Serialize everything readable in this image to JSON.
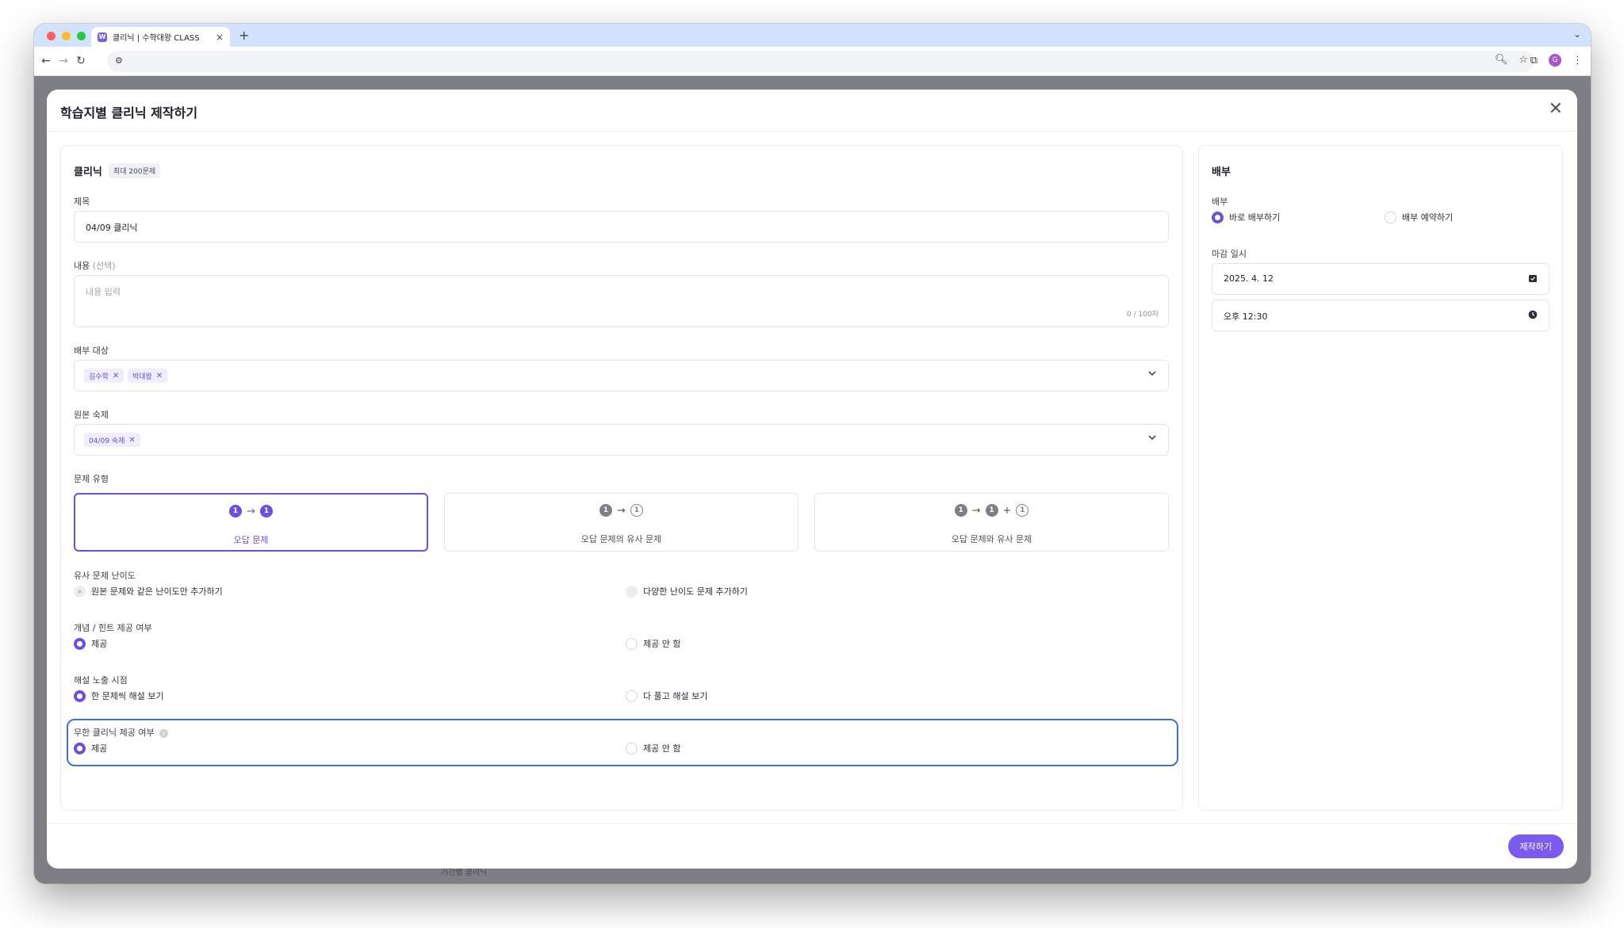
{
  "browser": {
    "tab_title": "클리닉 | 수학대왕 CLASS",
    "tab_favicon": "W",
    "new_tab": "+",
    "close_tab": "×",
    "profile_initial": "G",
    "accent": "#d3e3fd"
  },
  "background_hint": "기간별 클리닉",
  "modal": {
    "title": "학습지별 클리닉 제작하기",
    "close": "✕",
    "submit_label": "제작하기"
  },
  "clinic": {
    "section_title": "클리닉",
    "badge": "최대 200문제",
    "title_label": "제목",
    "title_value": "04/09 클리닉",
    "content_label": "내용",
    "content_optional": "(선택)",
    "content_placeholder": "내용 입력",
    "content_counter": "0 / 100자",
    "targets_label": "배부 대상",
    "targets": [
      "김수학",
      "박대왕"
    ],
    "homework_label": "원본 숙제",
    "homework": [
      "04/09 숙제"
    ],
    "type_label": "문제 유형",
    "types": [
      {
        "label": "오답 문제",
        "selected": true
      },
      {
        "label": "오답 문제의 유사 문제",
        "selected": false
      },
      {
        "label": "오답 문제와 유사 문제",
        "selected": false
      }
    ],
    "difficulty_label": "유사 문제 난이도",
    "difficulty_options": [
      "원본 문제와 같은 난이도만 추가하기",
      "다양한 난이도 문제 추가하기"
    ],
    "hint_label": "개념 / 힌트 제공 여부",
    "hint_options": [
      "제공",
      "제공 안 함"
    ],
    "solution_label": "해설 노출 시점",
    "solution_options": [
      "한 문제씩 해설 보기",
      "다 풀고 해설 보기"
    ],
    "infinite_label": "무한 클리닉 제공 여부",
    "infinite_options": [
      "제공",
      "제공 안 함"
    ]
  },
  "distribution": {
    "section_title": "배부",
    "mode_label": "배부",
    "mode_options": [
      "바로 배부하기",
      "배부 예약하기"
    ],
    "deadline_label": "마감 일시",
    "date_value": "2025. 4. 12",
    "time_value": "오후 12:30"
  },
  "colors": {
    "primary": "#7b5af0",
    "focus": "#3d6fe0"
  }
}
